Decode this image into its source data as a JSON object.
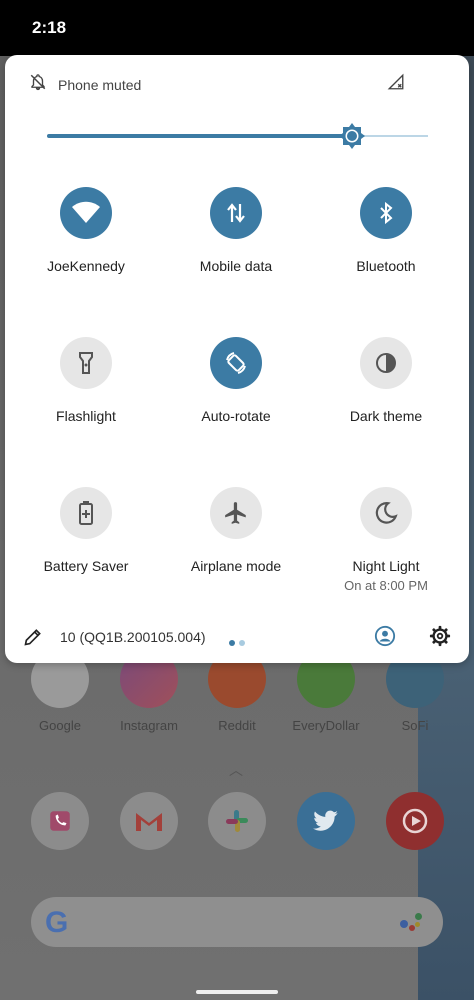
{
  "status_bar": {
    "time": "2:18"
  },
  "quick_settings": {
    "ringer_status": "Phone muted",
    "brightness": 0.77,
    "tiles": [
      {
        "label": "JoeKennedy",
        "icon": "wifi-icon",
        "active": true
      },
      {
        "label": "Mobile data",
        "icon": "mobile-data-icon",
        "active": true
      },
      {
        "label": "Bluetooth",
        "icon": "bluetooth-icon",
        "active": true
      },
      {
        "label": "Flashlight",
        "icon": "flashlight-icon",
        "active": false
      },
      {
        "label": "Auto-rotate",
        "icon": "auto-rotate-icon",
        "active": true
      },
      {
        "label": "Dark theme",
        "icon": "dark-theme-icon",
        "active": false
      },
      {
        "label": "Battery Saver",
        "icon": "battery-saver-icon",
        "active": false
      },
      {
        "label": "Airplane mode",
        "icon": "airplane-icon",
        "active": false
      },
      {
        "label": "Night Light",
        "sublabel": "On at 8:00 PM",
        "icon": "night-light-icon",
        "active": false
      }
    ],
    "build_number": "10 (QQ1B.200105.004)",
    "page_indicator": {
      "pages": 2,
      "current": 1
    }
  },
  "home_screen": {
    "apps": [
      "Google",
      "Instagram",
      "Reddit",
      "EveryDollar",
      "SoFi"
    ]
  },
  "colors": {
    "accent": "#3c7ba4",
    "tile_off": "#e6e6e6",
    "panel_bg": "#ffffff"
  }
}
